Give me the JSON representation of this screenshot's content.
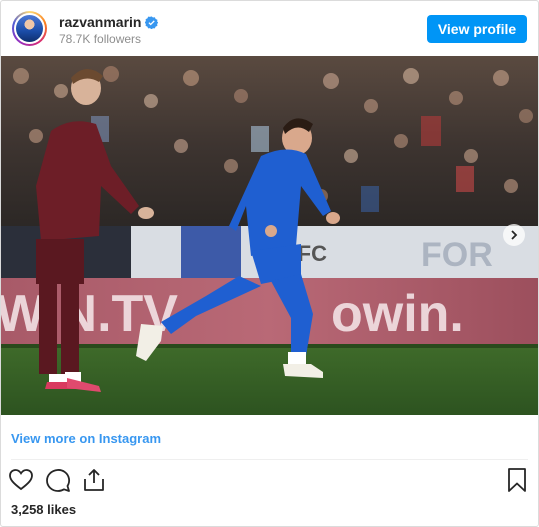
{
  "header": {
    "username": "razvanmarin",
    "followers": "78.7K followers",
    "view_profile_label": "View profile",
    "verified_icon": "verified-badge-icon"
  },
  "post": {
    "image_icon": "match-photo",
    "carousel": {
      "slides": 3,
      "active_index": 0
    },
    "background_banners": [
      "owin.",
      "WIN.TV",
      "EFC"
    ]
  },
  "footer": {
    "view_more_label": "View more on Instagram",
    "likes": "3,258 likes"
  },
  "icons": {
    "like": "heart-icon",
    "comment": "comment-icon",
    "share": "share-icon",
    "save": "bookmark-icon",
    "next": "chevron-right-icon"
  },
  "colors": {
    "accent": "#0095f6",
    "link": "#3897f0",
    "text": "#262626",
    "muted": "#8e8e8e"
  }
}
